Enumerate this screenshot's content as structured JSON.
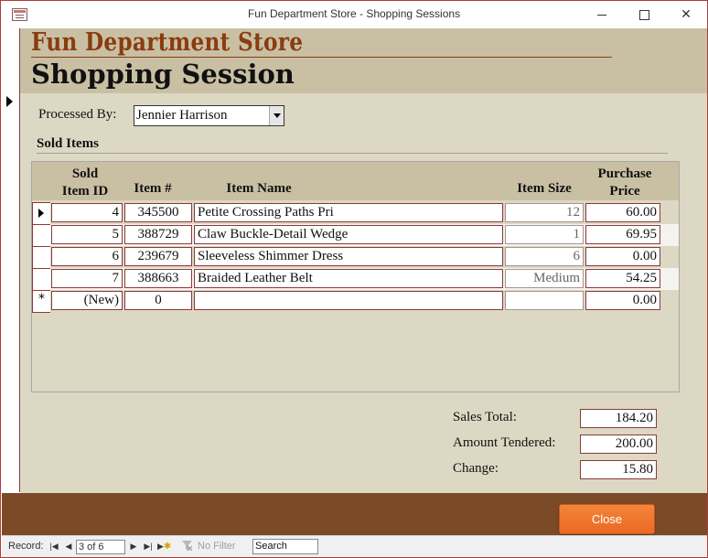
{
  "window": {
    "title": "Fun Department Store - Shopping Sessions"
  },
  "header": {
    "store_name": "Fun Department Store",
    "form_title": "Shopping Session"
  },
  "form": {
    "processed_by_label": "Processed By:",
    "processed_by_value": "Jennier Harrison",
    "sold_items_label": "Sold Items"
  },
  "subform": {
    "columns": {
      "sold_item_id": [
        "Sold",
        "Item ID"
      ],
      "item_no": "Item #",
      "item_name": "Item Name",
      "item_size": "Item Size",
      "purchase_price": [
        "Purchase",
        "Price"
      ]
    },
    "rows": [
      {
        "sold_item_id": "4",
        "item_no": "345500",
        "item_name": "Petite Crossing Paths Pri",
        "item_size": "12",
        "purchase_price": "60.00"
      },
      {
        "sold_item_id": "5",
        "item_no": "388729",
        "item_name": "Claw Buckle-Detail Wedge",
        "item_size": "1",
        "purchase_price": "69.95"
      },
      {
        "sold_item_id": "6",
        "item_no": "239679",
        "item_name": "Sleeveless Shimmer Dress",
        "item_size": "6",
        "purchase_price": "0.00"
      },
      {
        "sold_item_id": "7",
        "item_no": "388663",
        "item_name": "Braided Leather Belt",
        "item_size": "Medium",
        "purchase_price": "54.25"
      }
    ],
    "new_row": {
      "sold_item_id": "(New)",
      "item_no": "0",
      "item_name": "",
      "item_size": "",
      "purchase_price": "0.00"
    }
  },
  "totals": {
    "sales_total_label": "Sales Total:",
    "sales_total": "184.20",
    "amount_tendered_label": "Amount Tendered:",
    "amount_tendered": "200.00",
    "change_label": "Change:",
    "change": "15.80"
  },
  "footer": {
    "close_label": "Close"
  },
  "navigation": {
    "record_label": "Record:",
    "record_position": "3 of 6",
    "no_filter_label": "No Filter",
    "search_label": "Search"
  },
  "colors": {
    "brand_brown": "#8a3c10",
    "footer_brown": "#7b4b27",
    "header_tan": "#c9c0a4",
    "detail_beige": "#ddd8c4",
    "close_orange": "#f07a30"
  }
}
